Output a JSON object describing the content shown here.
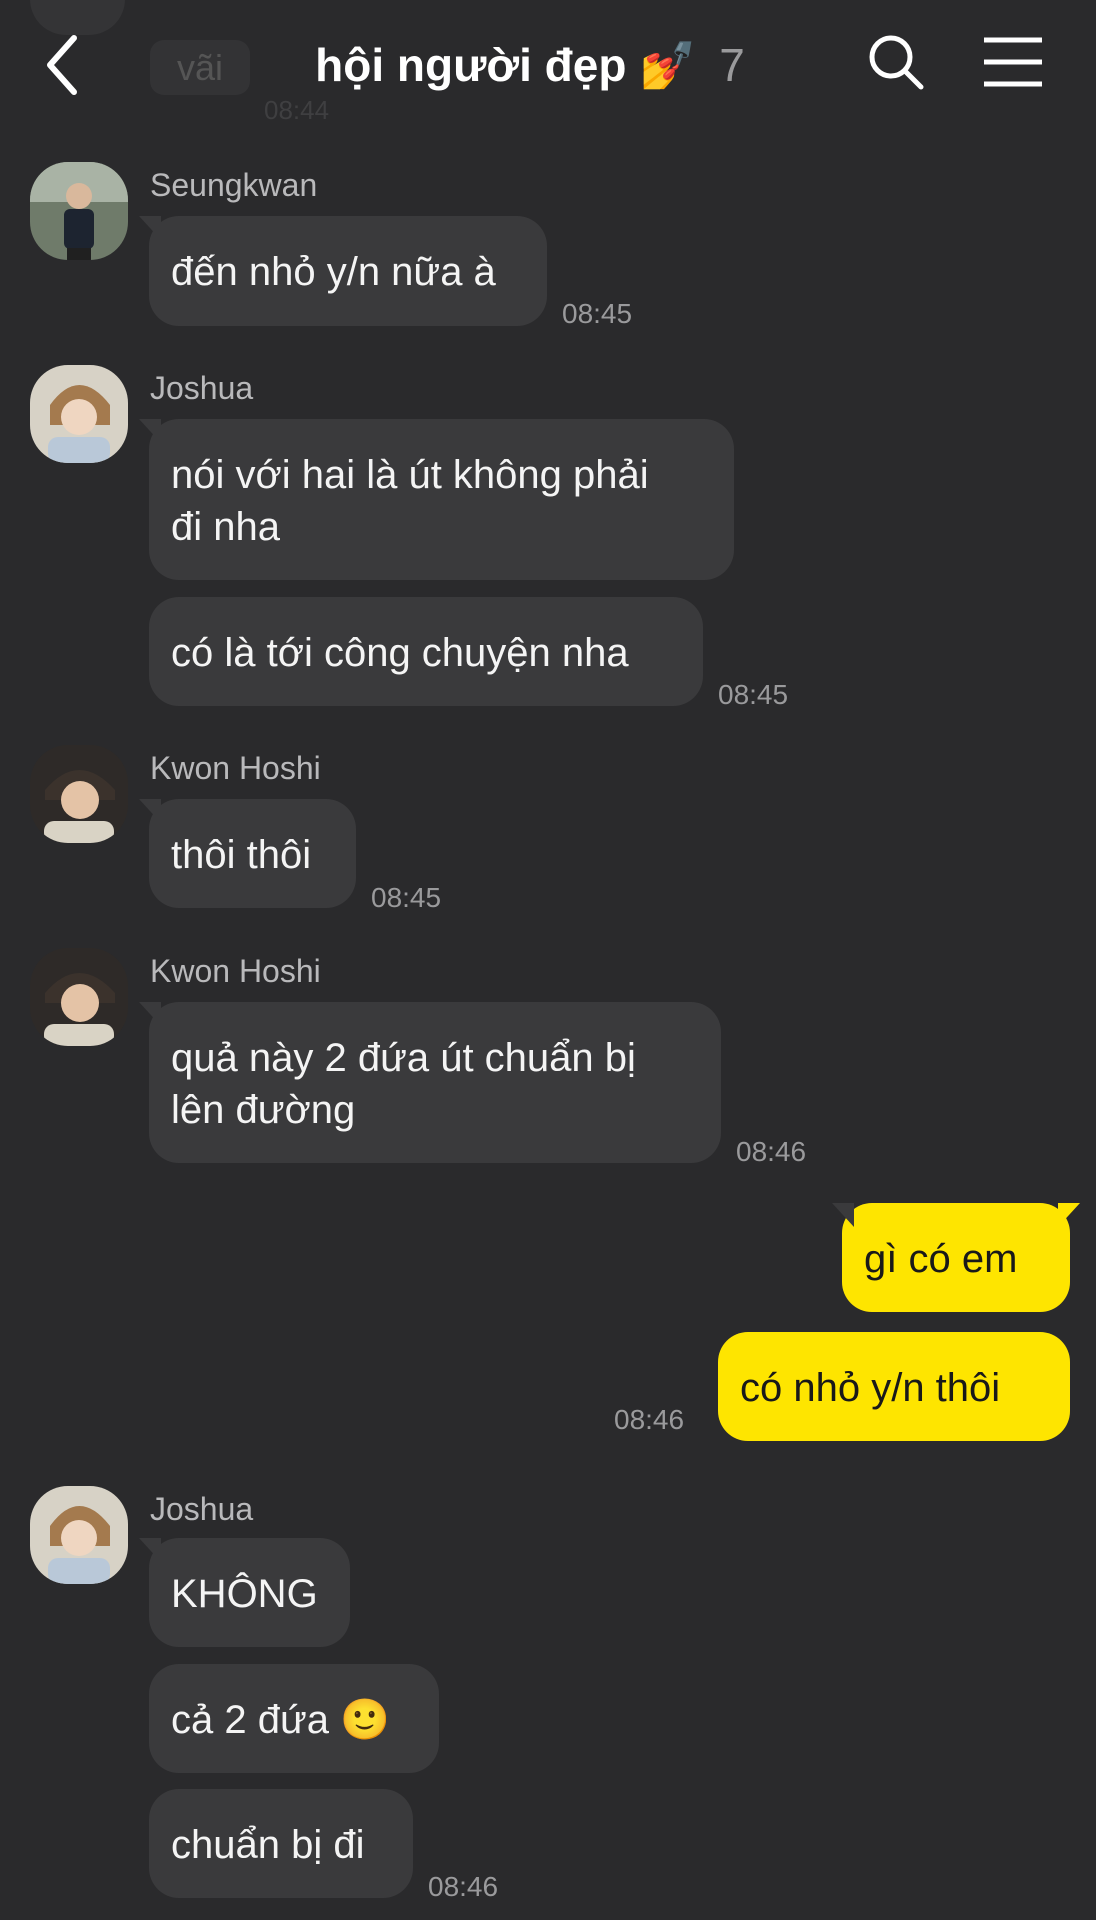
{
  "header": {
    "title": "hội người đẹp",
    "title_emoji": "💅",
    "member_count": "7",
    "icons": [
      "back-chevron-icon",
      "search-icon",
      "hamburger-menu-icon"
    ]
  },
  "faded_top": {
    "text": "vãi",
    "time": "08:44"
  },
  "colors": {
    "background": "#2a2a2c",
    "incoming_bubble": "#3a3a3c",
    "outgoing_bubble": "#fee500",
    "timestamp": "#9a9a9c"
  },
  "messages": [
    {
      "sender": "Seungkwan",
      "bubbles": [
        "đến nhỏ y/n nữa à"
      ],
      "time": "08:45"
    },
    {
      "sender": "Joshua",
      "bubbles": [
        "nói với hai là út không phải\nđi nha",
        "có là tới công chuyện nha"
      ],
      "time": "08:45"
    },
    {
      "sender": "Kwon Hoshi",
      "bubbles": [
        "thôi thôi"
      ],
      "time": "08:45"
    },
    {
      "sender": "Kwon Hoshi",
      "bubbles": [
        "quả này 2 đứa út chuẩn bị\nlên đường"
      ],
      "time": "08:46"
    },
    {
      "sender": "me",
      "bubbles": [
        "gì có em",
        "có nhỏ y/n thôi"
      ],
      "time": "08:46"
    },
    {
      "sender": "Joshua",
      "bubbles": [
        "KHÔNG",
        "cả 2 đứa 🙂",
        "chuẩn bị đi"
      ],
      "time": "08:46"
    }
  ]
}
